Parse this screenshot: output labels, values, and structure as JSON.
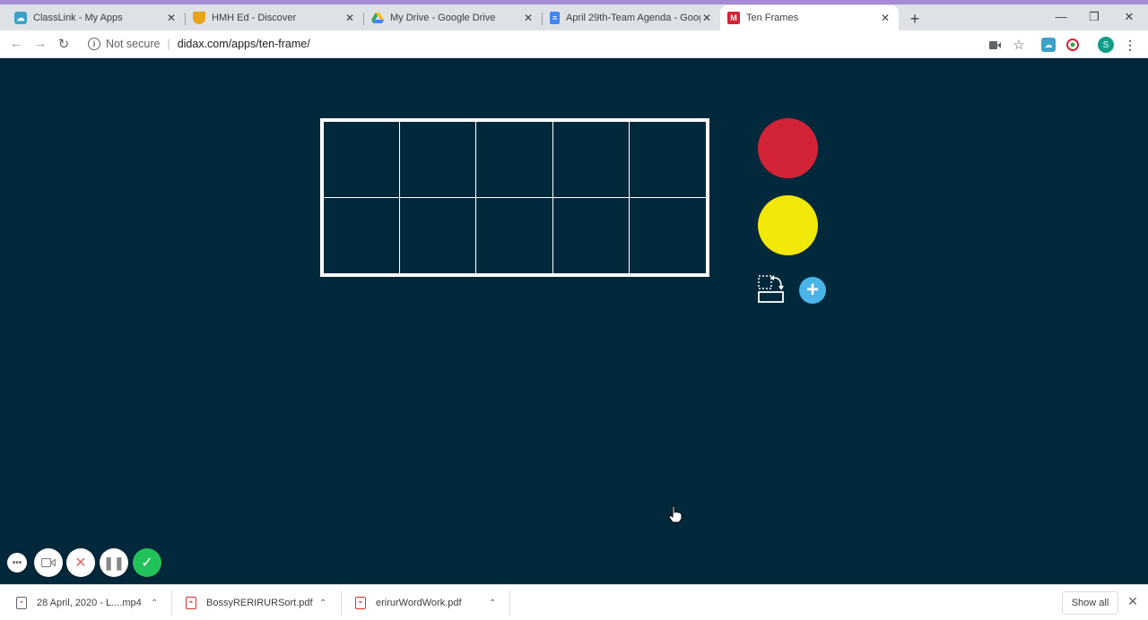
{
  "browser": {
    "tabs": [
      {
        "title": "ClassLink - My Apps",
        "icon": "classlink-icon",
        "color": "#3aa1c8"
      },
      {
        "title": "HMH Ed - Discover",
        "icon": "hmh-icon",
        "color": "#e8a317"
      },
      {
        "title": "My Drive - Google Drive",
        "icon": "google-drive-icon",
        "color": "#34a853"
      },
      {
        "title": "April 29th-Team Agenda - Goog",
        "icon": "google-docs-icon",
        "color": "#4285f4"
      },
      {
        "title": "Ten Frames",
        "icon": "didax-icon",
        "color": "#d32336"
      }
    ],
    "active_tab": "Ten Frames",
    "address": {
      "security": "Not secure",
      "url": "didax.com/apps/ten-frame/"
    },
    "profile_initial": "S"
  },
  "app": {
    "frame_rows": 2,
    "frame_cols": 5,
    "counters": [
      {
        "color_name": "red",
        "color": "#d32336"
      },
      {
        "color_name": "yellow",
        "color": "#f1e709"
      }
    ],
    "tools": [
      "rotate-frame-icon",
      "add-frame-icon"
    ],
    "background": "#02293b"
  },
  "recorder": {
    "buttons": [
      "more-icon",
      "webcam-icon",
      "cancel-icon",
      "pause-icon",
      "done-icon"
    ],
    "accent": "#22c25a"
  },
  "downloads": {
    "items": [
      {
        "name": "28 April, 2020 - L....mp4",
        "type": "video"
      },
      {
        "name": "BossyRERIRURSort.pdf",
        "type": "pdf"
      },
      {
        "name": "erirurWordWork.pdf",
        "type": "pdf"
      }
    ],
    "show_all_label": "Show all"
  }
}
